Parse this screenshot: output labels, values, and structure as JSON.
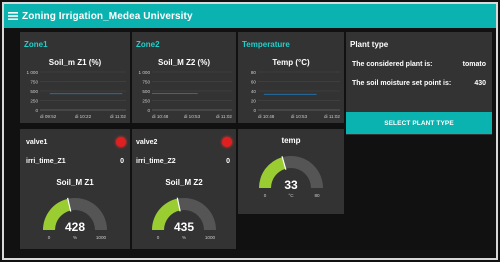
{
  "header": {
    "title": "Zoning Irrigation_Medea University",
    "menu_icon": "hamburger-icon"
  },
  "colors": {
    "accent": "#0bb3b0",
    "title_accent": "#20d0cc",
    "card": "#333333",
    "background": "#111111",
    "led_red": "#e02020",
    "gauge_fill": "#9acd32",
    "gauge_track": "#555555",
    "line": "#1f77b4"
  },
  "zone1": {
    "title": "Zone1",
    "chart": {
      "title": "Soil_m Z1 (%)",
      "y_ticks": [
        "1 000",
        "750",
        "500",
        "250",
        "0"
      ],
      "x_ticks": [
        "di 09:52",
        "di 10:22",
        "di 11:02"
      ]
    },
    "valve_label": "valve1",
    "irri_label": "irri_time_Z1",
    "irri_value": "0",
    "gauge": {
      "title": "Soil_M Z1",
      "value": "428",
      "min": "0",
      "max": "1000",
      "unit": "%",
      "fraction": 0.428
    }
  },
  "zone2": {
    "title": "Zone2",
    "chart": {
      "title": "Soil_M Z2 (%)",
      "y_ticks": [
        "1 000",
        "750",
        "500",
        "250",
        "0"
      ],
      "x_ticks": [
        "di 10:48",
        "di 10:53",
        "di 11:02"
      ]
    },
    "valve_label": "valve2",
    "irri_label": "irri_time_Z2",
    "irri_value": "0",
    "gauge": {
      "title": "Soil_M Z2",
      "value": "435",
      "min": "0",
      "max": "1000",
      "unit": "%",
      "fraction": 0.435
    }
  },
  "temperature": {
    "title": "Temperature",
    "chart": {
      "title": "Temp (°C)",
      "y_ticks": [
        "80",
        "60",
        "40",
        "20",
        "0"
      ],
      "x_ticks": [
        "di 10:48",
        "di 10:53",
        "di 11:02"
      ]
    },
    "gauge": {
      "title": "temp",
      "value": "33",
      "min": "0",
      "max": "80",
      "unit": "°C",
      "fraction": 0.4125
    }
  },
  "plant": {
    "title": "Plant type",
    "considered_label": "The considered plant is:",
    "considered_value": "tomato",
    "setpoint_label": "The soil moisture set point is:",
    "setpoint_value": "430",
    "button_label": "SELECT PLANT TYPE"
  },
  "chart_data": [
    {
      "type": "line",
      "title": "Soil_m Z1 (%)",
      "x_ticks": [
        "di 09:52",
        "di 10:22",
        "di 11:02"
      ],
      "ylim": [
        0,
        1000
      ],
      "series": [
        {
          "x": [
            "di 10:00",
            "di 10:59"
          ],
          "values": [
            428,
            428
          ]
        }
      ]
    },
    {
      "type": "line",
      "title": "Soil_M Z2 (%)",
      "x_ticks": [
        "di 10:48",
        "di 10:53",
        "di 11:02"
      ],
      "ylim": [
        0,
        1000
      ],
      "series": [
        {
          "x": [
            "di 10:48",
            "di 10:56"
          ],
          "values": [
            435,
            435
          ]
        }
      ]
    },
    {
      "type": "line",
      "title": "Temp (°C)",
      "x_ticks": [
        "di 10:48",
        "di 10:53",
        "di 11:02"
      ],
      "ylim": [
        0,
        80
      ],
      "series": [
        {
          "x": [
            "di 10:49",
            "di 10:58"
          ],
          "values": [
            33,
            33
          ]
        }
      ]
    }
  ]
}
